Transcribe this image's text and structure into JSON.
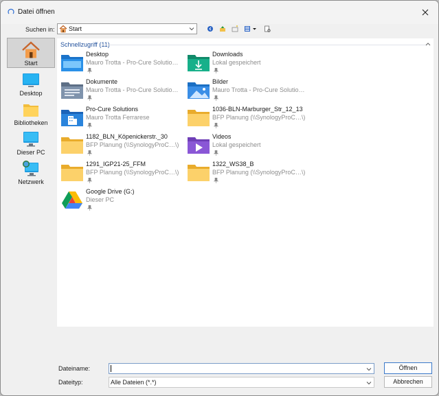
{
  "window": {
    "title": "Datei öffnen"
  },
  "toolbar": {
    "lookin_label": "Suchen in:",
    "lookin_value": "Start"
  },
  "places": [
    {
      "label": "Start",
      "icon": "home-icon",
      "selected": true
    },
    {
      "label": "Desktop",
      "icon": "desktop-icon"
    },
    {
      "label": "Bibliotheken",
      "icon": "libraries-icon"
    },
    {
      "label": "Dieser PC",
      "icon": "this-pc-icon"
    },
    {
      "label": "Netzwerk",
      "icon": "network-icon"
    }
  ],
  "quick_access": {
    "header": "Schnellzugriff (11)",
    "items": [
      {
        "name": "Desktop",
        "sub": "Mauro Trotta - Pro-Cure Solutio…",
        "icon": "desktop-folder-icon"
      },
      {
        "name": "Downloads",
        "sub": "Lokal gespeichert",
        "icon": "downloads-folder-icon"
      },
      {
        "name": "Dokumente",
        "sub": "Mauro Trotta - Pro-Cure Solutio…",
        "icon": "documents-folder-icon"
      },
      {
        "name": "Bilder",
        "sub": "Mauro Trotta - Pro-Cure Solutio…",
        "icon": "pictures-folder-icon"
      },
      {
        "name": "Pro-Cure Solutions",
        "sub": "Mauro Trotta Ferrarese",
        "icon": "company-folder-icon"
      },
      {
        "name": "1036-BLN-Marburger_Str_12_13",
        "sub": "BFP Planung (\\\\SynologyProC…\\)",
        "icon": "folder-icon"
      },
      {
        "name": "1182_BLN_Köpenickerstr._30",
        "sub": "BFP Planung (\\\\SynologyProC…\\)",
        "icon": "folder-icon"
      },
      {
        "name": "Videos",
        "sub": "Lokal gespeichert",
        "icon": "videos-folder-icon"
      },
      {
        "name": "1291_IGP21-25_FFM",
        "sub": "BFP Planung (\\\\SynologyProC…\\)",
        "icon": "folder-icon"
      },
      {
        "name": "1322_WS38_B",
        "sub": "BFP Planung (\\\\SynologyProC…\\)",
        "icon": "folder-icon"
      },
      {
        "name": "Google Drive (G:)",
        "sub": "Dieser PC",
        "icon": "google-drive-icon"
      }
    ]
  },
  "footer": {
    "filename_label": "Dateiname:",
    "filename_value": "",
    "filetype_label": "Dateityp:",
    "filetype_value": "Alle Dateien (*.*)",
    "open_label": "Öffnen",
    "cancel_label": "Abbrechen"
  },
  "colors": {
    "accent": "#1f4f9b",
    "folder_yellow": "#f5c24b",
    "focus_border": "#3a78c9"
  }
}
